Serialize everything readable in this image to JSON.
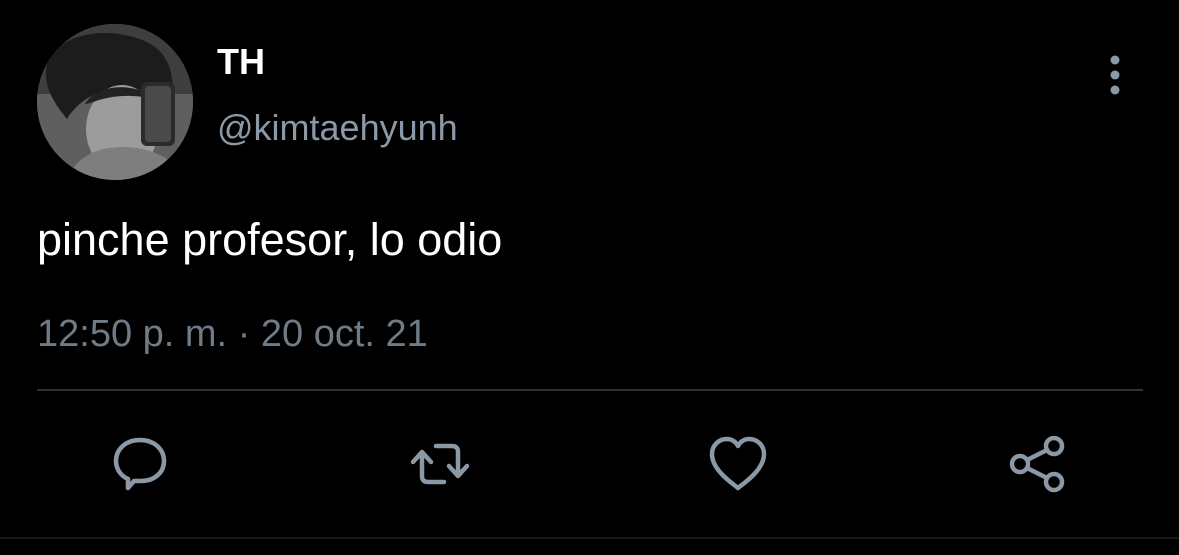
{
  "user": {
    "display_name": "TH",
    "handle": "@kimtaehyunh"
  },
  "tweet": {
    "text": "pinche profesor, lo odio",
    "time": "12:50 p. m.",
    "separator": "·",
    "date": "20 oct. 21"
  },
  "actions": {
    "reply_icon": "speech-bubble",
    "retweet_icon": "retweet-arrows",
    "like_icon": "heart",
    "share_icon": "share-nodes",
    "more_icon": "vertical-dots"
  },
  "colors": {
    "background": "#000000",
    "text_primary": "#ffffff",
    "text_secondary": "#8b98a5",
    "icon": "#8b98a5",
    "divider": "#2f3336"
  }
}
